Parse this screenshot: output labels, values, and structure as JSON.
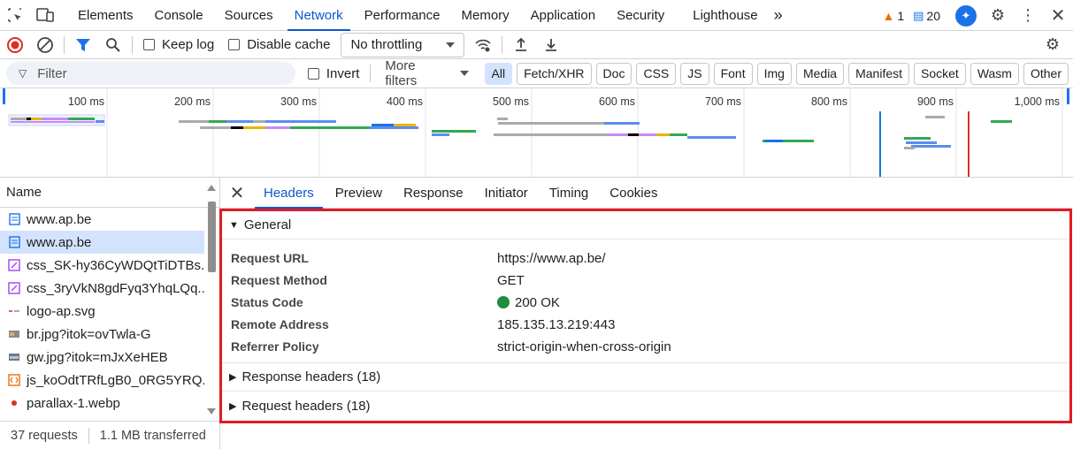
{
  "topbar": {
    "tabs": [
      "Elements",
      "Console",
      "Sources",
      "Network",
      "Performance",
      "Memory",
      "Application",
      "Security",
      "Lighthouse"
    ],
    "active_tab": "Network",
    "more_tabs_glyph": "»",
    "warnings_count": "1",
    "messages_count": "20"
  },
  "toolbar": {
    "preserve_log_label": "Keep log",
    "disable_cache_label": "Disable cache",
    "throttling_value": "No throttling"
  },
  "filterbar": {
    "filter_placeholder": "Filter",
    "invert_label": "Invert",
    "more_filters_label": "More filters",
    "type_buttons": [
      "All",
      "Fetch/XHR",
      "Doc",
      "CSS",
      "JS",
      "Font",
      "Img",
      "Media",
      "Manifest",
      "Socket",
      "Wasm",
      "Other"
    ]
  },
  "overview": {
    "ticks": [
      "100 ms",
      "200 ms",
      "300 ms",
      "400 ms",
      "500 ms",
      "600 ms",
      "700 ms",
      "800 ms",
      "900 ms",
      "1,000 ms"
    ]
  },
  "requests": {
    "header": "Name",
    "items": [
      {
        "name": "www.ap.be",
        "icon": "document-icon"
      },
      {
        "name": "www.ap.be",
        "icon": "document-icon"
      },
      {
        "name": "css_SK-hy36CyWDQtTiDTBs...",
        "icon": "stylesheet-icon"
      },
      {
        "name": "css_3ryVkN8gdFyq3YhqLQq...",
        "icon": "stylesheet-icon"
      },
      {
        "name": "logo-ap.svg",
        "icon": "svg-icon"
      },
      {
        "name": "br.jpg?itok=ovTwla-G",
        "icon": "image-icon"
      },
      {
        "name": "gw.jpg?itok=mJxXeHEB",
        "icon": "image-icon"
      },
      {
        "name": "js_koOdtTRfLgB0_0RG5YRQ...",
        "icon": "script-icon"
      },
      {
        "name": "parallax-1.webp",
        "icon": "webp-icon"
      }
    ],
    "selected_index": 1
  },
  "status": {
    "requests": "37 requests",
    "transferred": "1.1 MB transferred"
  },
  "details": {
    "tabs": [
      "Headers",
      "Preview",
      "Response",
      "Initiator",
      "Timing",
      "Cookies"
    ],
    "active_tab": "Headers",
    "general_title": "General",
    "general": [
      {
        "key": "Request URL",
        "value": "https://www.ap.be/"
      },
      {
        "key": "Request Method",
        "value": "GET"
      },
      {
        "key": "Status Code",
        "value": "200 OK"
      },
      {
        "key": "Remote Address",
        "value": "185.135.13.219:443"
      },
      {
        "key": "Referrer Policy",
        "value": "strict-origin-when-cross-origin"
      }
    ],
    "response_headers": "Response headers (18)",
    "request_headers": "Request headers (18)"
  },
  "colors": {
    "accent": "#0b57d0",
    "highlight_box": "#e01b24",
    "status_ok": "#1e8e3e",
    "warning": "#e37400"
  }
}
